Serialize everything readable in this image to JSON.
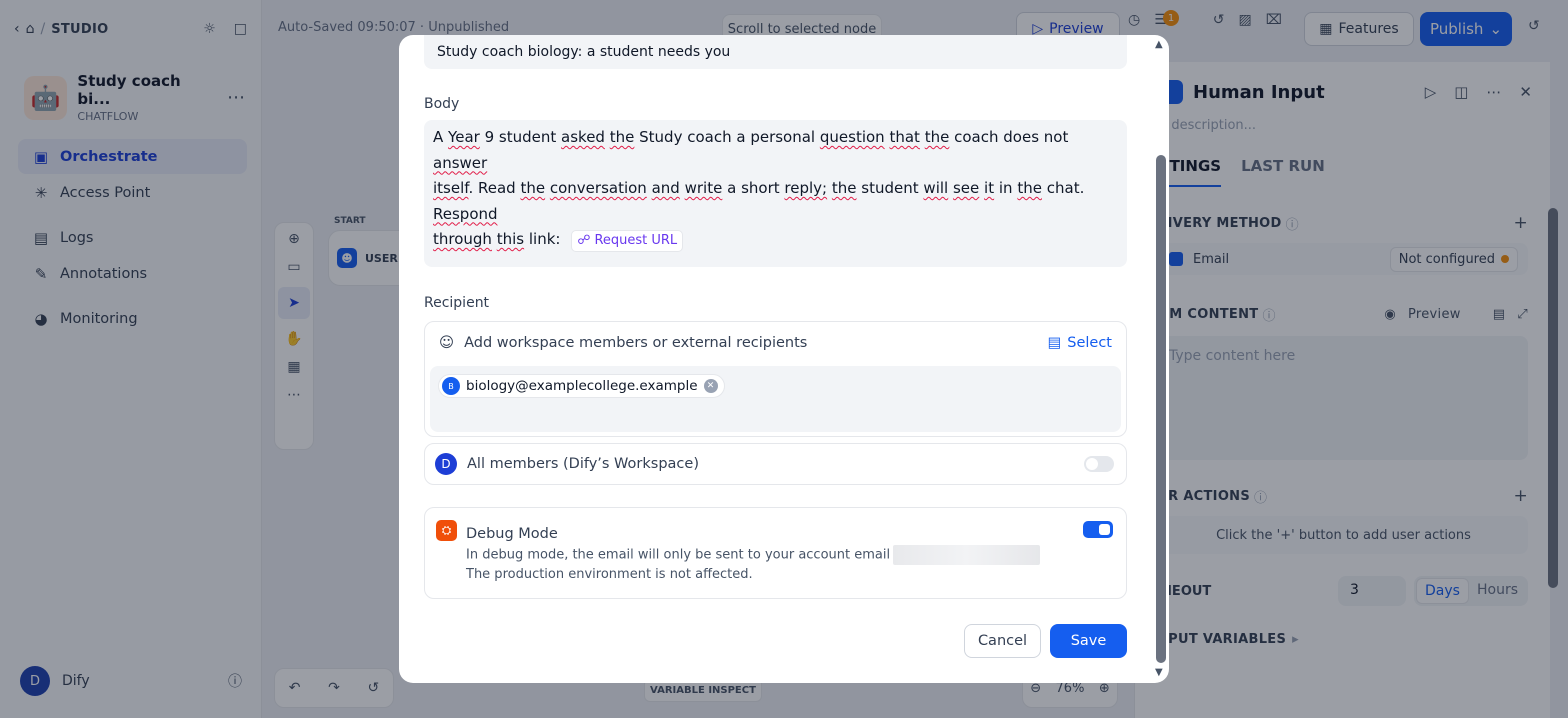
{
  "sidebar": {
    "breadcrumb": "STUDIO",
    "app": {
      "name": "Study coach bi...",
      "type": "CHATFLOW",
      "icon": "robot-icon"
    },
    "items": [
      {
        "label": "Orchestrate",
        "icon": "orchestrate-icon",
        "active": true
      },
      {
        "label": "Access Point",
        "icon": "access-point-icon"
      },
      {
        "label": "Logs",
        "icon": "logs-icon"
      },
      {
        "label": "Annotations",
        "icon": "annotations-icon"
      },
      {
        "label": "Monitoring",
        "icon": "monitoring-icon"
      }
    ],
    "user": {
      "initial": "D",
      "name": "Dify"
    }
  },
  "toolbar": {
    "autosave": "Auto-Saved 09:50:07 · Unpublished",
    "scroll_to_node": "Scroll to selected node",
    "preview": "Preview",
    "badge_count": "1",
    "features": "Features",
    "publish": "Publish"
  },
  "canvas": {
    "start_label": "START",
    "start_node_text": "USER IN",
    "variable_inspect": "VARIABLE INSPECT",
    "zoom": "76%"
  },
  "panel": {
    "title": "Human Input",
    "description_placeholder": "d description...",
    "tabs": [
      "TTINGS",
      "LAST RUN"
    ],
    "delivery_title": "LIVERY METHOD",
    "delivery_method": "Email",
    "delivery_status": "Not configured",
    "form_title": "RM CONTENT",
    "form_preview": "Preview",
    "form_placeholder": "Type content here",
    "user_actions_title": "ER ACTIONS",
    "user_actions_hint": "Click the '+' button to add user actions",
    "timeout_title": "MEOUT",
    "timeout_value": "3",
    "timeout_units": [
      "Days",
      "Hours"
    ],
    "output_title": "TPUT VARIABLES"
  },
  "modal": {
    "subject": "Study coach biology: a student needs you",
    "body_label": "Body",
    "body": {
      "w1": "A",
      "w2": "Year",
      "w3": "9 student",
      "w4": "asked",
      "w5": "the",
      "w6": "Study coach a personal",
      "w7": "question",
      "w8": "that",
      "w9": "the",
      "w10": "coach does not",
      "w11": "answer",
      "w12": "itself",
      "w13": ". Read",
      "w14": "the",
      "w15": "conversation",
      "w16": "and",
      "w17": "write",
      "w18": "a short",
      "w19": "reply;",
      "w20": "the",
      "w21": "student",
      "w22": "will",
      "w23": "see",
      "w24": "it",
      "w25": "in",
      "w26": "the",
      "w27": "chat.",
      "w28": "Respond",
      "w29": "through",
      "w30": "this",
      "w31": "link:",
      "chip": "Request URL"
    },
    "recipient_label": "Recipient",
    "recipient_hint": "Add workspace members or external recipients",
    "select_label": "Select",
    "recipients": [
      {
        "initial": "B",
        "email": "biology@examplecollege.example"
      }
    ],
    "all_members": {
      "initial": "D",
      "label": "All members (Dify’s Workspace)",
      "enabled": false
    },
    "debug": {
      "title": "Debug Mode",
      "line1": "In debug mode, the email will only be sent to your account email",
      "line2": "The production environment is not affected.",
      "enabled": true
    },
    "cancel": "Cancel",
    "save": "Save"
  }
}
